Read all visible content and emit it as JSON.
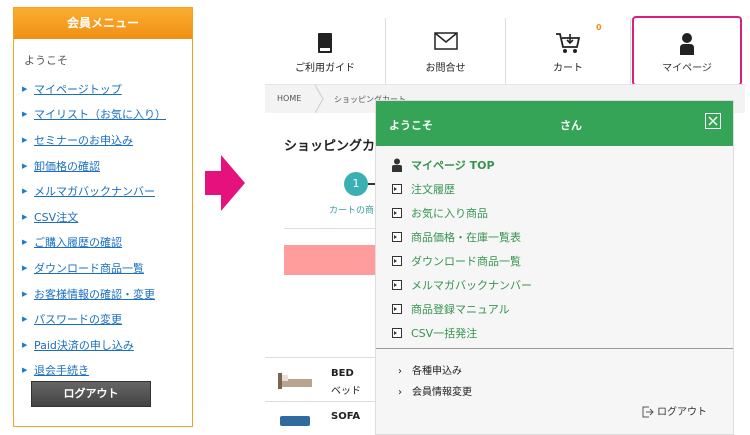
{
  "left_menu": {
    "header": "会員メニュー",
    "welcome": "ようこそ",
    "items": [
      "マイページトップ",
      "マイリスト（お気に入り）",
      "セミナーのお申込み",
      "卸価格の確認",
      "メルマガバックナンバー",
      "CSV注文",
      "ご購入履歴の確認",
      "ダウンロード商品一覧",
      "お客様情報の確認・変更",
      "パスワードの変更",
      "Paid決済の申し込み",
      "退会手続き"
    ],
    "logout": "ログアウト"
  },
  "nav": {
    "guide": "ご利用ガイド",
    "contact": "お問合せ",
    "cart": "カート",
    "cart_count": "0",
    "mypage": "マイページ"
  },
  "breadcrumb": {
    "home": "HOME",
    "current": "ショッピングカート"
  },
  "page": {
    "title": "ショッピングカ",
    "step_number": "1",
    "step_label": "カートの商"
  },
  "products": [
    {
      "name": "BED",
      "sub": "ベッド"
    },
    {
      "name": "SOFA",
      "sub": ""
    }
  ],
  "dropdown": {
    "welcome": "ようこそ",
    "san": "さん",
    "top": "マイページ TOP",
    "items": [
      "注文履歴",
      "お気に入り商品",
      "商品価格・在庫一覧表",
      "ダウンロード商品一覧",
      "メルマガバックナンバー",
      "商品登録マニュアル",
      "CSV一括発注"
    ],
    "sub_items": [
      "各種申込み",
      "会員情報変更"
    ],
    "logout": "ログアウト"
  },
  "colors": {
    "orange": "#f08f16",
    "green": "#36a457",
    "magenta": "#d9207e",
    "link_blue": "#1a6fc0"
  }
}
